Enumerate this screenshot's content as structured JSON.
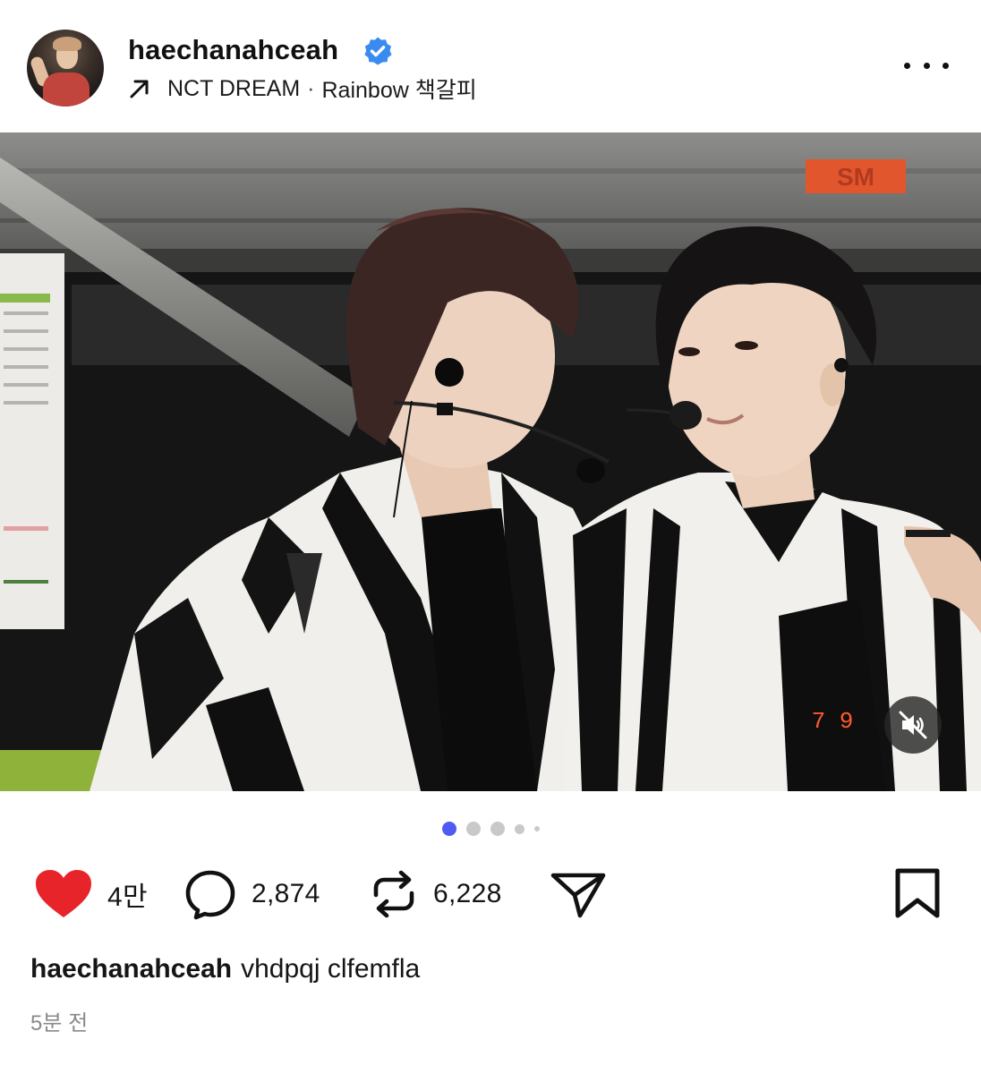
{
  "post": {
    "username": "haechanahceah",
    "verified": true,
    "linked_artist": "NCT DREAM",
    "separator": "·",
    "linked_track": "Rainbow 책갈피",
    "caption": "vhdpqj clfemfla",
    "time_ago": "5분 전"
  },
  "carousel": {
    "total_slides": 5,
    "active_index": 0
  },
  "actions": {
    "likes": "4만",
    "comments": "2,874",
    "reposts": "6,228"
  },
  "photo": {
    "signage_text": "SM",
    "led_digits": "7  9"
  },
  "icons": {
    "verified": "verified-badge-icon",
    "link": "arrow-up-right-icon",
    "more": "more-horizontal-icon",
    "mute": "speaker-muted-icon",
    "like": "heart-filled-icon",
    "comment": "comment-bubble-icon",
    "repost": "repost-icon",
    "share": "send-icon",
    "save": "bookmark-icon"
  },
  "colors": {
    "like_red": "#e8242b",
    "verified_blue": "#3a8bf0",
    "dot_active": "#4f5bf2",
    "dot_inactive": "#c9c9c9",
    "text_muted": "#8a8a8a"
  }
}
